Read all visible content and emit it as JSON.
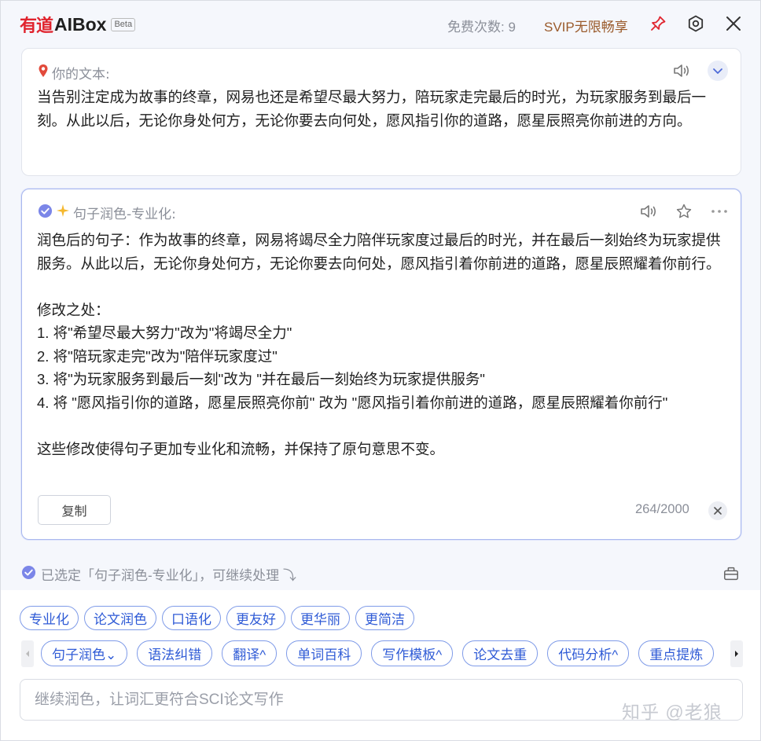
{
  "header": {
    "logo_cn": "有道",
    "logo_en": "AIBox",
    "beta_badge": "Beta",
    "free_count": "免费次数: 9",
    "svip": "SVIP无限畅享"
  },
  "source_card": {
    "label": "你的文本:",
    "text": "当告别注定成为故事的终章，网易也还是希望尽最大努力，陪玩家走完最后的时光，为玩家服务到最后一刻。从此以后，无论你身处何方，无论你要去向何处，愿风指引你的道路，愿星辰照亮你前进的方向。"
  },
  "result_card": {
    "label": "句子润色-专业化:",
    "text": "润色后的句子：作为故事的终章，网易将竭尽全力陪伴玩家度过最后的时光，并在最后一刻始终为玩家提供服务。从此以后，无论你身处何方，无论你要去向何处，愿风指引着你前进的道路，愿星辰照耀着你前行。\n\n修改之处：\n1. 将\"希望尽最大努力\"改为\"将竭尽全力\"\n2. 将\"陪玩家走完\"改为\"陪伴玩家度过\"\n3. 将\"为玩家服务到最后一刻\"改为 \"并在最后一刻始终为玩家提供服务\"\n4. 将 \"愿风指引你的道路，愿星辰照亮你前\" 改为 \"愿风指引着你前进的道路，愿星辰照耀着你前行\"\n\n这些修改使得句子更加专业化和流畅，并保持了原句意思不变。",
    "copy_label": "复制",
    "char_count": "264/2000"
  },
  "selected_status": "已选定「句子润色-专业化」，可继续处理 ⤵",
  "style_chips": [
    "专业化",
    "论文润色",
    "口语化",
    "更友好",
    "更华丽",
    "更简洁"
  ],
  "tool_chips": [
    "句子润色⌄",
    "语法纠错",
    "翻译^",
    "单词百科",
    "写作模板^",
    "论文去重",
    "代码分析^",
    "重点提炼"
  ],
  "input": {
    "placeholder": "继续润色，让词汇更符合SCI论文写作",
    "value": ""
  },
  "watermark": "知乎 @老狼",
  "colors": {
    "brand_red": "#e0242e",
    "chip_blue": "#2f5bd6",
    "svip_brown": "#9a5a2b",
    "check_purple": "#7b86e8"
  }
}
